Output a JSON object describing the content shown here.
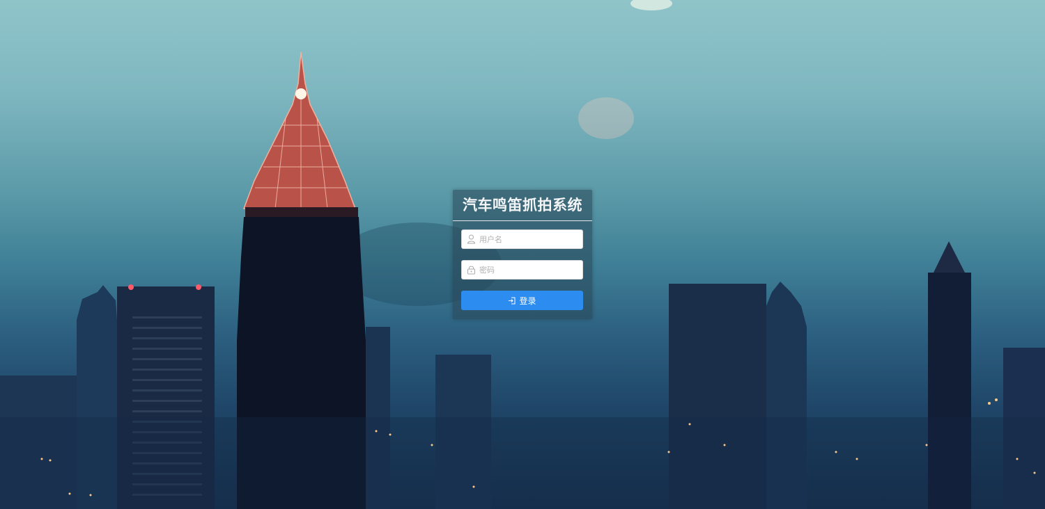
{
  "login": {
    "title": "汽车鸣笛抓拍系统",
    "username": {
      "placeholder": "用户名",
      "value": "",
      "icon": "user-icon"
    },
    "password": {
      "placeholder": "密码",
      "value": "",
      "icon": "lock-icon"
    },
    "submit": {
      "label": "登录",
      "icon": "login-icon",
      "color": "#2d8cf0"
    }
  }
}
